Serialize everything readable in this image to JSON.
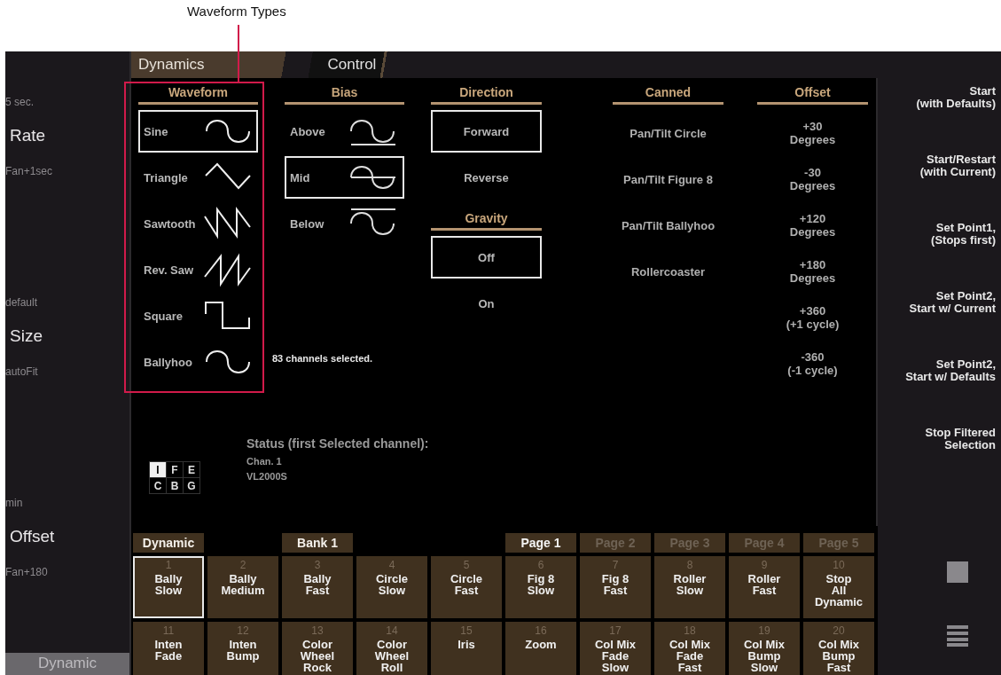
{
  "annotation": {
    "label": "Waveform Types"
  },
  "tabs": [
    {
      "label": "Dynamics",
      "selected": true
    },
    {
      "label": "Control",
      "selected": false
    }
  ],
  "sidebar": {
    "groups": [
      {
        "top": "5 sec.",
        "title": "Rate",
        "bottom": "Fan+1sec"
      },
      {
        "top": "default",
        "title": "Size",
        "bottom": "autoFit"
      },
      {
        "top": "min",
        "title": "Offset",
        "bottom": "Fan+180"
      }
    ],
    "tab": "Dynamic"
  },
  "waveform": {
    "title": "Waveform",
    "items": [
      {
        "label": "Sine",
        "kind": "sine",
        "selected": true
      },
      {
        "label": "Triangle",
        "kind": "triangle",
        "selected": false
      },
      {
        "label": "Sawtooth",
        "kind": "sawtooth",
        "selected": false
      },
      {
        "label": "Rev. Saw",
        "kind": "revsaw",
        "selected": false
      },
      {
        "label": "Square",
        "kind": "square",
        "selected": false
      },
      {
        "label": "Ballyhoo",
        "kind": "ballyhoo",
        "selected": false
      }
    ]
  },
  "bias": {
    "title": "Bias",
    "items": [
      {
        "label": "Above",
        "kind": "above",
        "selected": false
      },
      {
        "label": "Mid",
        "kind": "mid",
        "selected": true
      },
      {
        "label": "Below",
        "kind": "below",
        "selected": false
      }
    ]
  },
  "direction": {
    "title": "Direction",
    "items": [
      {
        "label": "Forward",
        "selected": true
      },
      {
        "label": "Reverse",
        "selected": false
      }
    ]
  },
  "gravity": {
    "title": "Gravity",
    "items": [
      {
        "label": "Off",
        "selected": true
      },
      {
        "label": "On",
        "selected": false
      }
    ]
  },
  "canned": {
    "title": "Canned",
    "items": [
      "Pan/Tilt Circle",
      "Pan/Tilt Figure 8",
      "Pan/Tilt Ballyhoo",
      "Rollercoaster"
    ]
  },
  "offset": {
    "title": "Offset",
    "items": [
      [
        "+30",
        "Degrees"
      ],
      [
        "-30",
        "Degrees"
      ],
      [
        "+120",
        "Degrees"
      ],
      [
        "+180",
        "Degrees"
      ],
      [
        "+360",
        "(+1 cycle)"
      ],
      [
        "-360",
        "(-1 cycle)"
      ]
    ]
  },
  "selection_note": "83 channels selected.",
  "status": {
    "title": "Status (first Selected channel):",
    "lines": [
      "Chan. 1",
      "VL2000S"
    ],
    "flags": [
      {
        "label": "I",
        "selected": true
      },
      {
        "label": "F",
        "selected": false
      },
      {
        "label": "E",
        "selected": false
      },
      {
        "label": "C",
        "selected": false
      },
      {
        "label": "B",
        "selected": false
      },
      {
        "label": "G",
        "selected": false
      }
    ]
  },
  "actions": [
    [
      "Start",
      "(with Defaults)"
    ],
    [
      "Start/Restart",
      "(with Current)"
    ],
    [
      "Set Point1,",
      "(Stops first)"
    ],
    [
      "Set Point2,",
      "Start w/ Current"
    ],
    [
      "Set Point2,",
      "Start w/ Defaults"
    ],
    [
      "Stop Filtered",
      "Selection"
    ]
  ],
  "bank": {
    "mode": "Dynamic",
    "bank": "Bank 1",
    "pages": [
      {
        "label": "Page 1",
        "selected": true
      },
      {
        "label": "Page 2",
        "selected": false
      },
      {
        "label": "Page 3",
        "selected": false
      },
      {
        "label": "Page 4",
        "selected": false
      },
      {
        "label": "Page 5",
        "selected": false
      }
    ],
    "buttons": [
      {
        "number": "1",
        "lines": [
          "Bally",
          "Slow"
        ],
        "selected": true
      },
      {
        "number": "2",
        "lines": [
          "Bally",
          "Medium"
        ],
        "selected": false
      },
      {
        "number": "3",
        "lines": [
          "Bally",
          "Fast"
        ],
        "selected": false
      },
      {
        "number": "4",
        "lines": [
          "Circle",
          "Slow"
        ],
        "selected": false
      },
      {
        "number": "5",
        "lines": [
          "Circle",
          "Fast"
        ],
        "selected": false
      },
      {
        "number": "6",
        "lines": [
          "Fig 8",
          "Slow"
        ],
        "selected": false
      },
      {
        "number": "7",
        "lines": [
          "Fig 8",
          "Fast"
        ],
        "selected": false
      },
      {
        "number": "8",
        "lines": [
          "Roller",
          "Slow"
        ],
        "selected": false
      },
      {
        "number": "9",
        "lines": [
          "Roller",
          "Fast"
        ],
        "selected": false
      },
      {
        "number": "10",
        "lines": [
          "Stop",
          "All",
          "Dynamic"
        ],
        "selected": false
      },
      {
        "number": "11",
        "lines": [
          "Inten",
          "Fade"
        ],
        "selected": false
      },
      {
        "number": "12",
        "lines": [
          "Inten",
          "Bump"
        ],
        "selected": false
      },
      {
        "number": "13",
        "lines": [
          "Color",
          "Wheel",
          "Rock"
        ],
        "selected": false
      },
      {
        "number": "14",
        "lines": [
          "Color",
          "Wheel",
          "Roll"
        ],
        "selected": false
      },
      {
        "number": "15",
        "lines": [
          "Iris"
        ],
        "selected": false
      },
      {
        "number": "16",
        "lines": [
          "Zoom"
        ],
        "selected": false
      },
      {
        "number": "17",
        "lines": [
          "Col Mix",
          "Fade",
          "Slow"
        ],
        "selected": false
      },
      {
        "number": "18",
        "lines": [
          "Col Mix",
          "Fade",
          "Fast"
        ],
        "selected": false
      },
      {
        "number": "19",
        "lines": [
          "Col Mix",
          "Bump",
          "Slow"
        ],
        "selected": false
      },
      {
        "number": "20",
        "lines": [
          "Col Mix",
          "Bump",
          "Fast"
        ],
        "selected": false
      }
    ]
  }
}
